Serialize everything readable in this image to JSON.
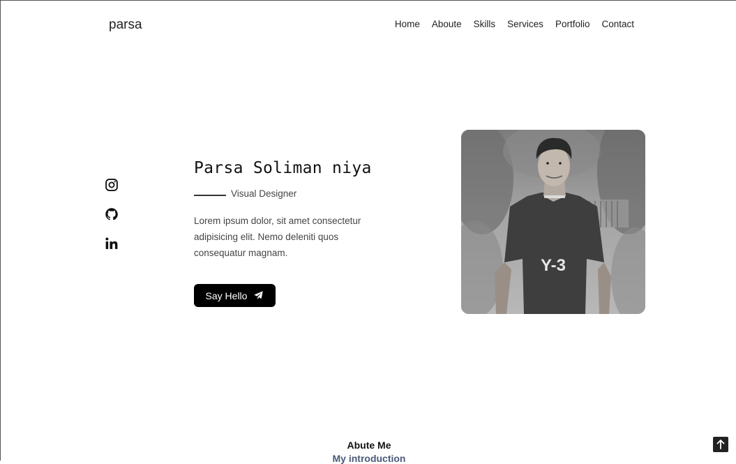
{
  "header": {
    "logo": "parsa",
    "nav": [
      "Home",
      "Aboute",
      "Skills",
      "Services",
      "Portfolio",
      "Contact"
    ]
  },
  "socials": [
    "instagram-icon",
    "github-icon",
    "linkedin-icon"
  ],
  "hero": {
    "name": "Parsa Soliman niya",
    "subtitle": "Visual Designer",
    "description": [
      "Lorem ipsum dolor, sit amet consectetur",
      "adipisicing elit. Nemo deleniti quos",
      "consequatur magnam."
    ],
    "cta_label": "Say Hello",
    "cta_icon": "send-icon",
    "photo_shirt_text": "Y-3"
  },
  "about": {
    "title": "Abute Me",
    "subtitle": "My introduction"
  },
  "scroll_top_icon": "arrow-up-icon"
}
